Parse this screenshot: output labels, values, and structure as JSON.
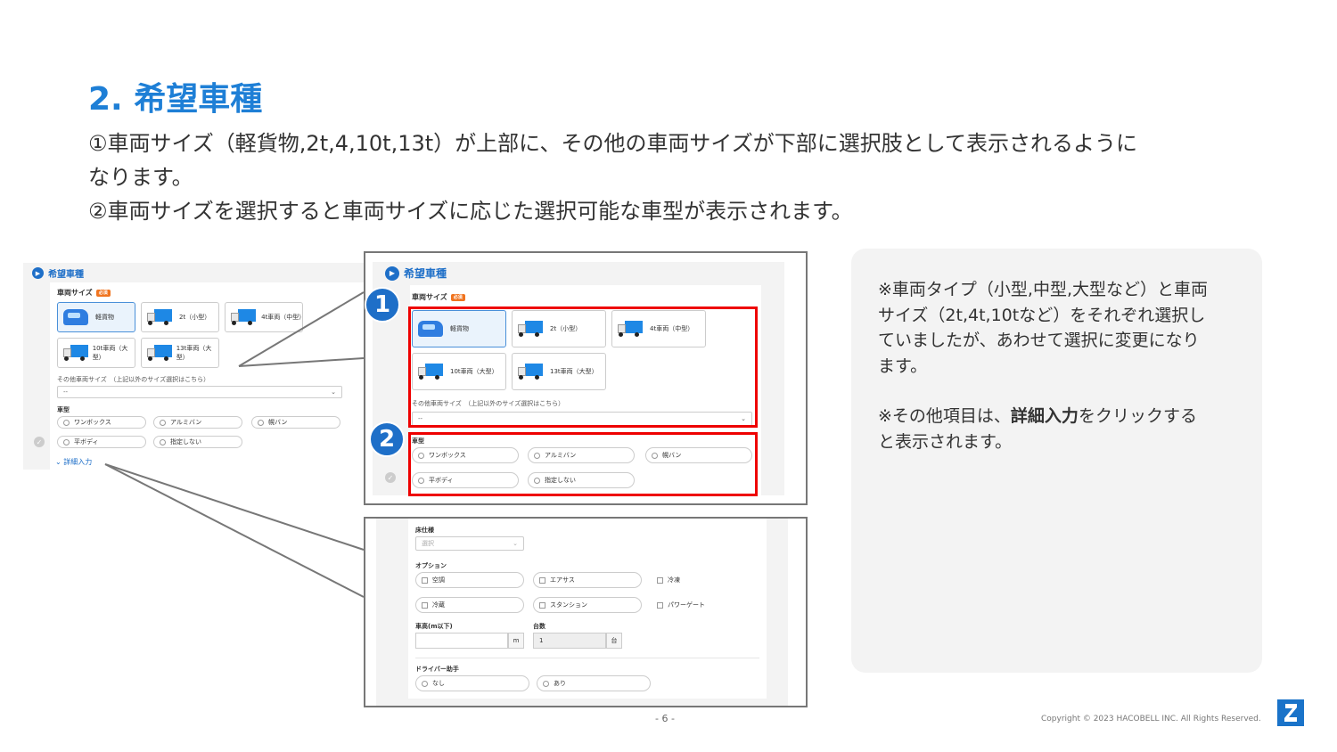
{
  "title": "2. 希望車種",
  "description": {
    "line1": "①車両サイズ（軽貨物,2t,4,10t,13t）が上部に、その他の車両サイズが下部に選択肢として表示されるように",
    "line2": "なります。",
    "line3": "②車両サイズを選択すると車両サイズに応じた選択可能な車型が表示されます。"
  },
  "form": {
    "section_title": "希望車種",
    "vehicle_size_label": "車両サイズ",
    "required_badge": "必須",
    "sizes": [
      "軽貨物",
      "2t（小型）",
      "4t車両（中型）",
      "10t車両（大型）",
      "13t車両（大型）"
    ],
    "other_size_label": "その他車両サイズ　（上記以外のサイズ選択はこちら）",
    "other_size_value": "--",
    "body_type_label": "車型",
    "body_types": [
      "ワンボックス",
      "アルミバン",
      "幌バン",
      "平ボディ",
      "指定しない"
    ],
    "detail_link": "詳細入力",
    "detail_chevron": "chevron-down-icon"
  },
  "badges": [
    "1",
    "2"
  ],
  "details": {
    "floor_label": "床仕様",
    "floor_placeholder": "選択",
    "options_label": "オプション",
    "options": [
      "空調",
      "エアサス",
      "冷凍",
      "冷蔵",
      "スタンション",
      "パワーゲート"
    ],
    "height_label": "車高(m以下)",
    "height_unit": "m",
    "count_label": "台数",
    "count_value": "1",
    "count_unit": "台",
    "assistant_label": "ドライバー助手",
    "assistant_options": [
      "なし",
      "あり"
    ]
  },
  "note": {
    "line1": "※車両タイプ（小型,中型,大型など）と車両",
    "line2": "サイズ（2t,4t,10tなど）をそれぞれ選択し",
    "line3": "ていましたが、あわせて選択に変更になり",
    "line4": "ます。",
    "line5_pre": "※その他項目は、",
    "line5_bold": "詳細入力",
    "line5_post": "をクリックする",
    "line6": "と表示されます。"
  },
  "page_number": "- 6 -",
  "copyright": "Copyright © 2023 HACOBELL INC. All Rights Reserved.",
  "colors": {
    "title": "#1e7fd6",
    "accent": "#1e6fc8",
    "highlight": "#e00000",
    "logo": "#1a73c9"
  }
}
